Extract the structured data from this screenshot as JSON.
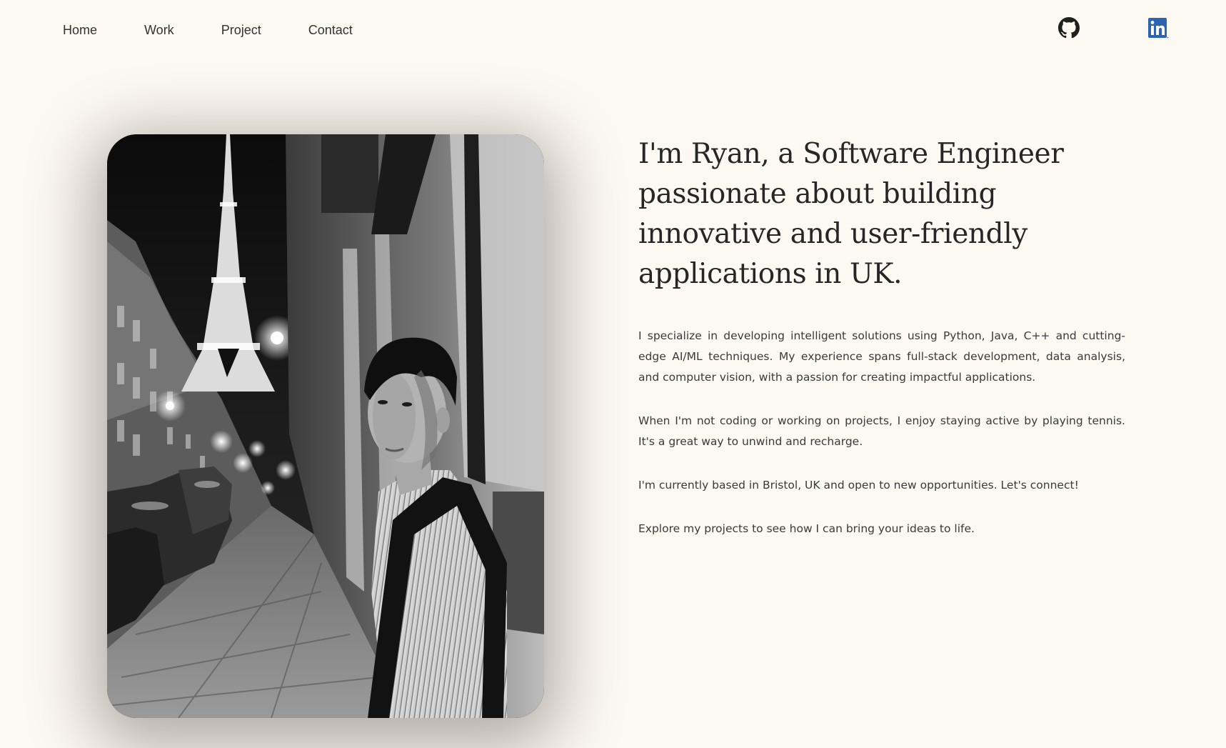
{
  "nav": {
    "links": [
      {
        "label": "Home"
      },
      {
        "label": "Work"
      },
      {
        "label": "Project"
      },
      {
        "label": "Contact"
      }
    ],
    "social": [
      {
        "icon": "github-icon"
      },
      {
        "icon": "linkedin-icon"
      }
    ]
  },
  "colors": {
    "background": "#fcf8f2",
    "text": "#2b2b2b",
    "linkedin": "#2d64b0"
  },
  "hero": {
    "photo_alt": "Black and white photo of a man on a Paris street with the Eiffel Tower at night",
    "headline": "I'm Ryan, a Software Engineer passionate about building innovative and user-friendly applications in UK.",
    "paragraphs": [
      "I specialize in developing intelligent solutions using Python, Java, C++ and cutting-edge AI/ML techniques. My experience spans full-stack development, data analysis, and computer vision, with a passion for creating impactful applications.",
      "When I'm not coding or working on projects, I enjoy staying active by playing tennis. It's a great way to unwind and recharge.",
      "I'm currently based in Bristol, UK and open to new opportunities. Let's connect!",
      "Explore my projects to see how I can bring your ideas to life."
    ]
  }
}
